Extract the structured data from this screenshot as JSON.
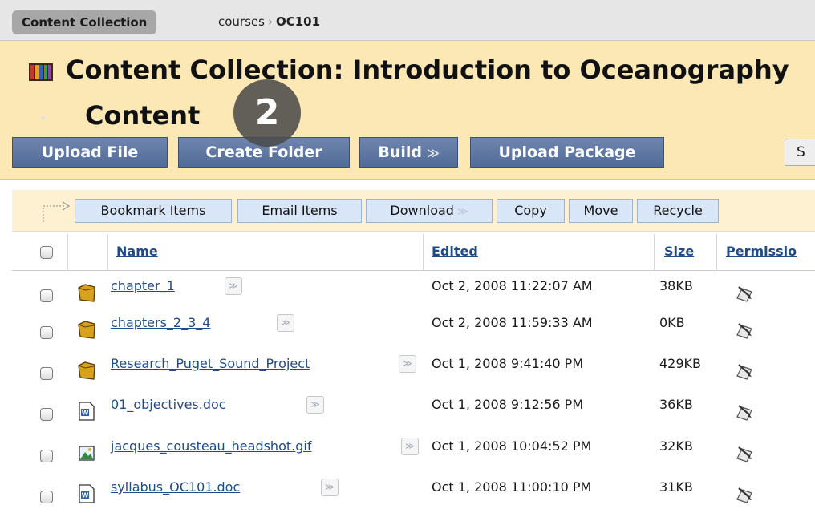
{
  "breadcrumb": {
    "home": "Content Collection",
    "path": [
      "courses",
      "OC101"
    ]
  },
  "header": {
    "title_line1": "Content Collection: Introduction to Oceanography",
    "title_line2": "Content",
    "step_badge": "2",
    "buttons": {
      "upload_file": "Upload File",
      "create_folder": "Create Folder",
      "build": "Build",
      "upload_package": "Upload Package",
      "search_stub": "S"
    }
  },
  "actions": {
    "bookmark": "Bookmark Items",
    "email": "Email Items",
    "download": "Download",
    "copy": "Copy",
    "move": "Move",
    "recycle": "Recycle"
  },
  "table": {
    "columns": {
      "name": "Name",
      "edited": "Edited",
      "size": "Size",
      "permissions": "Permissio"
    },
    "rows": [
      {
        "icon": "folder-icon",
        "name": "chapter_1",
        "edited": "Oct 2, 2008 11:22:07 AM",
        "size": "38KB"
      },
      {
        "icon": "folder-icon",
        "name": "chapters_2_3_4",
        "edited": "Oct 2, 2008 11:59:33 AM",
        "size": "0KB"
      },
      {
        "icon": "folder-icon",
        "name": "Research_Puget_Sound_Project",
        "edited": "Oct 1, 2008 9:41:40 PM",
        "size": "429KB"
      },
      {
        "icon": "word-doc-icon",
        "name": "01_objectives.doc",
        "edited": "Oct 1, 2008 9:12:56 PM",
        "size": "36KB"
      },
      {
        "icon": "image-file-icon",
        "name": "jacques_cousteau_headshot.gif",
        "edited": "Oct 1, 2008 10:04:52 PM",
        "size": "32KB"
      },
      {
        "icon": "word-doc-icon",
        "name": "syllabus_OC101.doc",
        "edited": "Oct 1, 2008 11:00:10 PM",
        "size": "31KB"
      }
    ]
  }
}
